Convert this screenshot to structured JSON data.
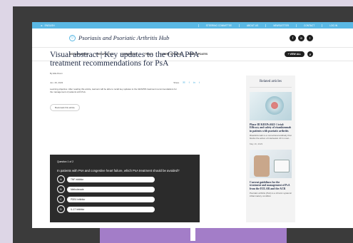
{
  "topbar": {
    "language": "ENGLISH",
    "links": [
      "STEERING COMMITTEE",
      "ABOUT US",
      "NEWSLETTER",
      "CONTACT",
      "LOG IN"
    ]
  },
  "brand": {
    "title": "Psoriasis and Psoriatic Arthritis Hub",
    "logo_icon": "figure-icon",
    "social": [
      "f",
      "in",
      "t"
    ]
  },
  "nav": {
    "items": [
      "DISEASE AREAS",
      "THERAPEUTICS",
      "CONGRESSES",
      "TRIALS",
      "EXPERT OPINIONS",
      "DRUG UPDATES"
    ],
    "view_all": "+ VIEW ALL",
    "search_icon": "⌕"
  },
  "article": {
    "title": "Visual abstract | Key updates to the GRAPPA treatment recommendations for PsA",
    "byline": "By Ella Dixon",
    "date": "Jun. 29, 2023",
    "share_label": "Share",
    "share_icons": [
      "✉",
      "f",
      "in",
      "t"
    ],
    "objective": "Learning objective: After reading this article, learners will be able to recall key updates to the GRAPPA treatment recommendations for the management of patients with PsA.",
    "bookmark": "Bookmark this article"
  },
  "quiz": {
    "question_number": "Question 1 of 2",
    "question": "In patients with PsA and congestive heart failure, which PsA treatment should be avoided?",
    "options": [
      {
        "letter": "A",
        "text": "TNF inhibitor"
      },
      {
        "letter": "B",
        "text": "Methotrexate"
      },
      {
        "letter": "C",
        "text": "PDE4 inhibitor"
      },
      {
        "letter": "D",
        "text": "IL-17 inhibitor"
      }
    ]
  },
  "sidebar": {
    "title": "Related articles",
    "articles": [
      {
        "heading": "Phase III KEEPsAKE-1 trial: Efficacy and safety of risankizumab in patients with psoriatic arthritis",
        "description": "Risankizumab is a monoclonal antibody that blocks the action of interleukin 23 in most...",
        "date": "May 16, 2023"
      },
      {
        "heading": "Current guidelines for the treatment and management of PsA from the EULAR and the ACR",
        "description": "Psoriatic arthritis (PsA) is a chronic systemic inflammatory condition"
      }
    ]
  },
  "colors": {
    "accent": "#5ab8e4",
    "quiz_bg": "#2b2b2b",
    "outer_bg": "#ddd6e6",
    "frame": "#3b3b3b",
    "purple_bar": "#a37dc8"
  }
}
